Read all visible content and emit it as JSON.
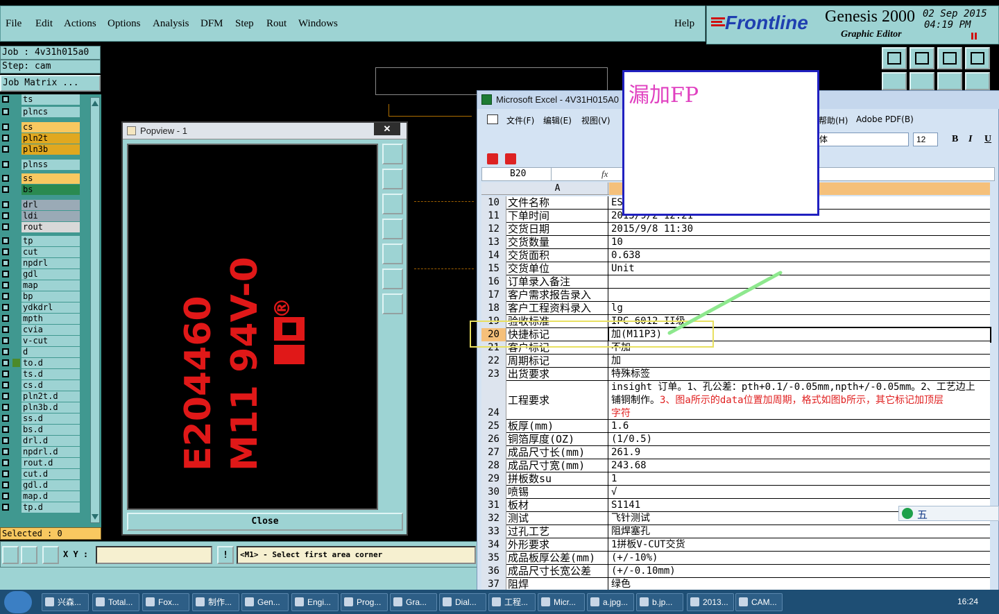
{
  "menu": {
    "items": [
      "File",
      "Edit",
      "Actions",
      "Options",
      "Analysis",
      "DFM",
      "Step",
      "Rout",
      "Windows"
    ],
    "help": "Help"
  },
  "brand": {
    "logo": "Frontline",
    "product": "Genesis 2000",
    "subtitle": "Graphic Editor",
    "date": "02 Sep 2015",
    "time": "04:19 PM"
  },
  "job": {
    "job": "Job : 4v31h015a0",
    "step": "Step: cam",
    "matrix": "Job Matrix ..."
  },
  "layers": [
    "ts",
    "plncs",
    "cs",
    "pln2t",
    "pln3b",
    "plnss",
    "ss",
    "bs",
    "drl",
    "ldi",
    "rout",
    "tp",
    "cut",
    "npdrl",
    "gdl",
    "map",
    "bp",
    "ydkdrl",
    "mpth",
    "cvia",
    "v-cut",
    "d",
    "to.d",
    "ts.d",
    "cs.d",
    "pln2t.d",
    "pln3b.d",
    "ss.d",
    "bs.d",
    "drl.d",
    "npdrl.d",
    "rout.d",
    "cut.d",
    "gdl.d",
    "map.d",
    "tp.d"
  ],
  "status": {
    "selected": "Selected : 0",
    "xy_label": "X Y :",
    "prompt": "<M1> - Select first area corner"
  },
  "popview": {
    "title": "Popview - 1",
    "close": "Close",
    "text1": "E204460",
    "text2": "M11 94V-0",
    "mark": "®"
  },
  "note": {
    "text": "漏加FP"
  },
  "excel": {
    "title": "Microsoft Excel - 4V31H015A0",
    "menu": [
      "文件(F)",
      "编辑(E)",
      "视图(V)"
    ],
    "menu_right": [
      "帮助(H)",
      "Adobe PDF(B)"
    ],
    "font_tail": "体",
    "font_size": "12",
    "bold": "B",
    "italic": "I",
    "underline": "U",
    "cellref": "B20",
    "fx": "fx",
    "col_a": "A",
    "rows": [
      {
        "n": "10",
        "a": "文件名称",
        "b": "ES"
      },
      {
        "n": "11",
        "a": "下单时间",
        "b": "2015/9/2 12:21"
      },
      {
        "n": "12",
        "a": "交货日期",
        "b": "2015/9/8 11:30"
      },
      {
        "n": "13",
        "a": "交货数量",
        "b": "10"
      },
      {
        "n": "14",
        "a": "交货面积",
        "b": "0.638"
      },
      {
        "n": "15",
        "a": "交货单位",
        "b": "Unit"
      },
      {
        "n": "16",
        "a": "订单录入备注",
        "b": ""
      },
      {
        "n": "17",
        "a": "客户需求报告录入",
        "b": ""
      },
      {
        "n": "18",
        "a": "客户工程资料录入",
        "b": "lg"
      },
      {
        "n": "19",
        "a": "验收标准",
        "b": "IPC-6012 II级"
      },
      {
        "n": "20",
        "a": "快捷标记",
        "b": "加(M11P3)"
      },
      {
        "n": "21",
        "a": "客户标记",
        "b": "不加"
      },
      {
        "n": "22",
        "a": "周期标记",
        "b": "加"
      },
      {
        "n": "23",
        "a": "出货要求",
        "b": "特殊标签"
      },
      {
        "n": "24",
        "a": "工程要求",
        "b": ""
      },
      {
        "n": "25",
        "a": "板厚(mm)",
        "b": "1.6"
      },
      {
        "n": "26",
        "a": "铜箔厚度(OZ)",
        "b": "(1/0.5)"
      },
      {
        "n": "27",
        "a": "成品尺寸长(mm)",
        "b": "261.9"
      },
      {
        "n": "28",
        "a": "成品尺寸宽(mm)",
        "b": "243.68"
      },
      {
        "n": "29",
        "a": "拼板数su",
        "b": "1"
      },
      {
        "n": "30",
        "a": "喷锡",
        "b": "√"
      },
      {
        "n": "31",
        "a": "板材",
        "b": "S1141"
      },
      {
        "n": "32",
        "a": "测试",
        "b": "飞针测试"
      },
      {
        "n": "33",
        "a": "过孔工艺",
        "b": "阻焊塞孔"
      },
      {
        "n": "34",
        "a": "外形要求",
        "b": "1拼板V-CUT交货"
      },
      {
        "n": "35",
        "a": "成品板厚公差(mm)",
        "b": "(+/-10%)"
      },
      {
        "n": "36",
        "a": "成品尺寸长宽公差",
        "b": "(+/-0.10mm)"
      },
      {
        "n": "37",
        "a": "阻焊",
        "b": "绿色"
      }
    ],
    "row24_line1": "insight 订单。1、孔公差：pth+0.1/-0.05mm,npth+/-0.05mm。2、工艺边上",
    "row24_line2a": "铺铜制作。",
    "row24_line2b": "3、图a所示的data位置加周期，格式如图b所示，其它标记加顶层",
    "row24_line3": "字符"
  },
  "ime": {
    "label": "五"
  },
  "taskbar": {
    "items": [
      "兴森...",
      "Total...",
      "Fox...",
      "制作...",
      "Gen...",
      "Engi...",
      "Prog...",
      "Gra...",
      "Dial...",
      "工程...",
      "Micr...",
      "a.jpg...",
      "b.jp...",
      "2013...",
      "CAM..."
    ],
    "clock": "16:24"
  }
}
